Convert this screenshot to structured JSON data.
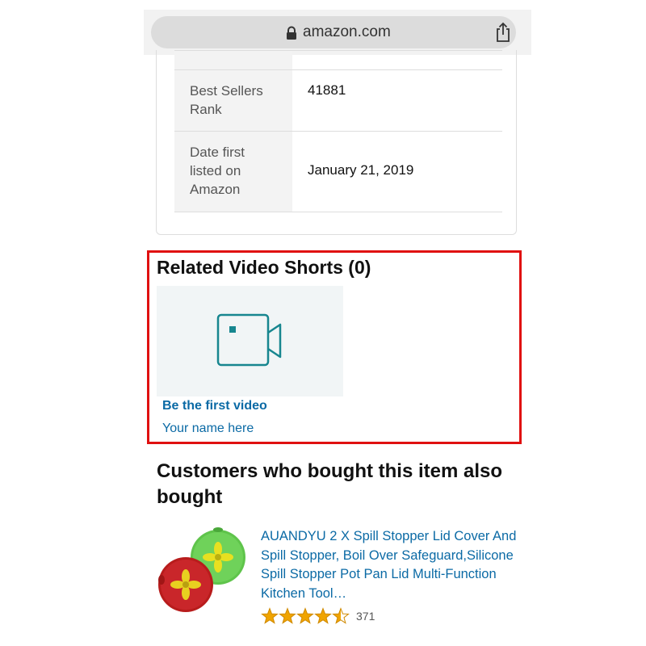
{
  "browser": {
    "url": "amazon.com"
  },
  "product_details": {
    "rows": [
      {
        "label": "Best Sellers Rank",
        "value": "41881"
      },
      {
        "label": "Date first listed on Amazon",
        "value": "January 21, 2019"
      }
    ]
  },
  "related_video_shorts": {
    "heading": "Related Video Shorts (0)",
    "card_title": "Be the first video",
    "card_subtitle": "Your name here"
  },
  "customers_also_bought": {
    "heading": "Customers who bought this item also bought",
    "items": [
      {
        "title": "AUANDYU 2 X Spill Stopper Lid Cover And Spill Stopper, Boil Over Safeguard,Silicone Spill Stopper Pot Pan Lid Multi-Function Kitchen Tool…",
        "rating": 4.5,
        "review_count": "371"
      }
    ]
  },
  "colors": {
    "link": "#0b6aa5",
    "highlight_border": "#e01010",
    "star": "#f0a400",
    "video_icon": "#17868f"
  },
  "icons": [
    "lock-icon",
    "share-icon",
    "video-camera-icon",
    "star-icon"
  ]
}
